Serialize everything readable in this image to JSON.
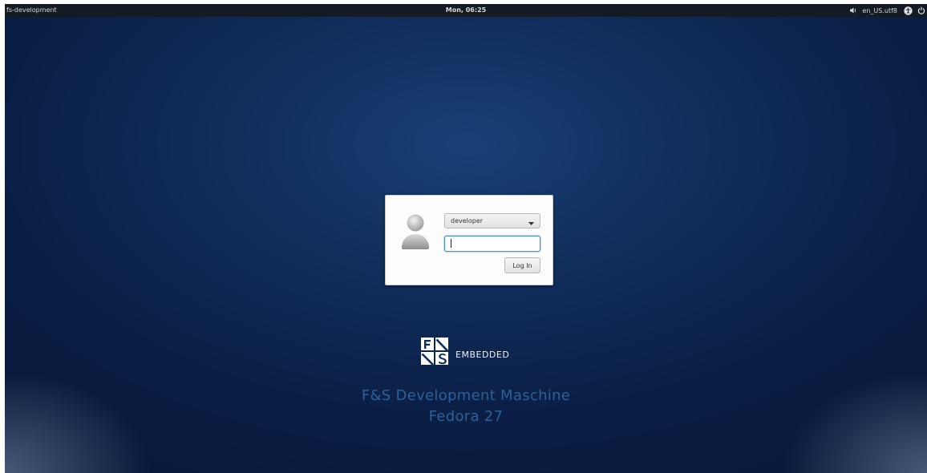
{
  "topbar": {
    "hostname": "fs-development",
    "clock": "Mon, 06:25",
    "locale": "en_US.utf8",
    "icons": [
      "volume-icon",
      "accessibility-icon",
      "power-icon"
    ]
  },
  "login": {
    "selected_user": "developer",
    "password_value": "",
    "button_label": "Log In"
  },
  "branding": {
    "logo_letters": "F S",
    "logo_text": "EMBEDDED",
    "title": "F&S Development Maschine",
    "subtitle": "Fedora 27"
  },
  "colors": {
    "accent": "#4a90d9",
    "title": "#2f5f98",
    "topbar": "#141b24"
  }
}
